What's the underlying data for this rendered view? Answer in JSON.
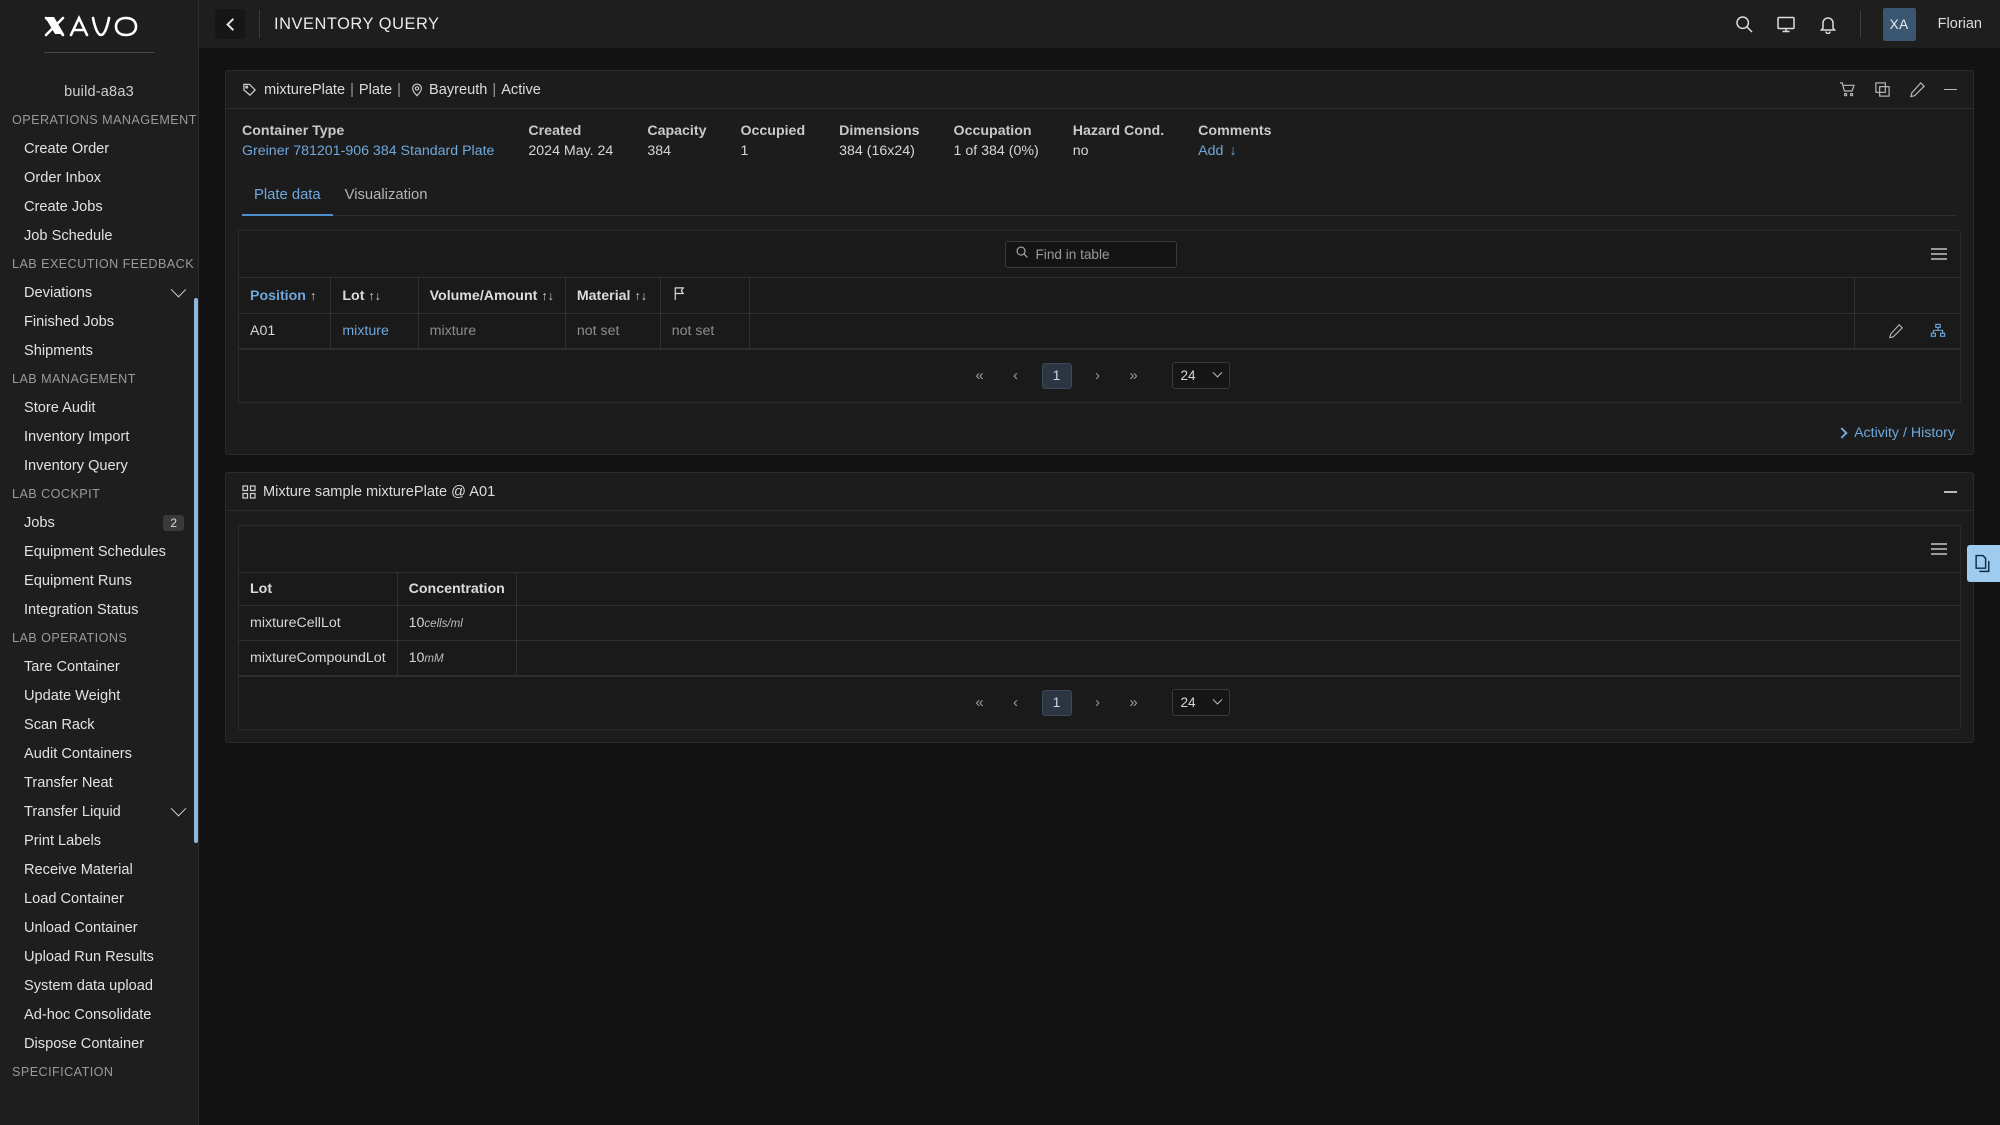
{
  "brand": {
    "logo_text": "XAVO",
    "build": "build-a8a3"
  },
  "sidebar": {
    "sections": [
      {
        "title": "OPERATIONS MANAGEMENT",
        "items": [
          {
            "label": "Create Order"
          },
          {
            "label": "Order Inbox"
          },
          {
            "label": "Create Jobs"
          },
          {
            "label": "Job Schedule"
          }
        ]
      },
      {
        "title": "LAB EXECUTION FEEDBACK",
        "items": [
          {
            "label": "Deviations",
            "expand": true
          },
          {
            "label": "Finished Jobs"
          },
          {
            "label": "Shipments"
          }
        ]
      },
      {
        "title": "LAB MANAGEMENT",
        "items": [
          {
            "label": "Store Audit"
          },
          {
            "label": "Inventory Import"
          },
          {
            "label": "Inventory Query"
          }
        ]
      },
      {
        "title": "LAB COCKPIT",
        "items": [
          {
            "label": "Jobs",
            "badge": "2"
          },
          {
            "label": "Equipment Schedules"
          },
          {
            "label": "Equipment Runs"
          },
          {
            "label": "Integration Status"
          }
        ]
      },
      {
        "title": "LAB OPERATIONS",
        "items": [
          {
            "label": "Tare Container"
          },
          {
            "label": "Update Weight"
          },
          {
            "label": "Scan Rack"
          },
          {
            "label": "Audit Containers"
          },
          {
            "label": "Transfer Neat"
          },
          {
            "label": "Transfer Liquid",
            "expand": true
          },
          {
            "label": "Print Labels"
          },
          {
            "label": "Receive Material"
          },
          {
            "label": "Load Container"
          },
          {
            "label": "Unload Container"
          },
          {
            "label": "Upload Run Results"
          },
          {
            "label": "System data upload"
          },
          {
            "label": "Ad-hoc Consolidate"
          },
          {
            "label": "Dispose Container"
          }
        ]
      },
      {
        "title": "SPECIFICATION",
        "items": []
      }
    ]
  },
  "topbar": {
    "title": "INVENTORY QUERY",
    "back_icon": "chevron-left-icon",
    "search_icon": "search-icon",
    "display_icon": "monitor-icon",
    "notification_icon": "bell-icon",
    "avatar_initials": "XA",
    "user_name": "Florian"
  },
  "container_card": {
    "breadcrumb": {
      "tag_icon": "tag-icon",
      "name": "mixturePlate",
      "sep1": "|",
      "type": "Plate",
      "sep2": "|",
      "location_icon": "location-pin-icon",
      "location": "Bayreuth",
      "sep3": "|",
      "status": "Active"
    },
    "head_icons": [
      "cart-icon",
      "copy-icon",
      "pencil-icon",
      "minimize-icon"
    ],
    "meta": [
      {
        "key": "Container Type",
        "value": "Greiner 781201-906 384 Standard Plate",
        "link": true
      },
      {
        "key": "Created",
        "value": "2024 May. 24"
      },
      {
        "key": "Capacity",
        "value": "384"
      },
      {
        "key": "Occupied",
        "value": "1"
      },
      {
        "key": "Dimensions",
        "value": "384 (16x24)"
      },
      {
        "key": "Occupation",
        "value": "1 of 384 (0%)"
      },
      {
        "key": "Hazard Cond.",
        "value": "no"
      },
      {
        "key": "Comments",
        "value": "Add",
        "add": true
      }
    ],
    "tabs": [
      {
        "label": "Plate data",
        "active": true
      },
      {
        "label": "Visualization",
        "active": false
      }
    ],
    "search": {
      "placeholder": "Find in table",
      "value": "",
      "icon": "search-icon"
    },
    "menu_icon": "list-menu-icon",
    "table": {
      "columns": [
        {
          "label": "Position",
          "sort": "↑",
          "highlight": true
        },
        {
          "label": "Lot",
          "sort": "↑↓"
        },
        {
          "label": "Volume/Amount",
          "sort": "↑↓"
        },
        {
          "label": "Material",
          "sort": "↑↓"
        },
        {
          "label": "",
          "icon": "flag-icon"
        }
      ],
      "rows": [
        {
          "position": "A01",
          "lot": "mixture",
          "volume": "mixture",
          "material": "not set",
          "flag": "not set",
          "actions": [
            "pencil-icon",
            "hierarchy-icon"
          ]
        }
      ]
    },
    "pager": {
      "first": "«",
      "prev": "‹",
      "page": "1",
      "next": "›",
      "last": "»",
      "page_size": "24"
    },
    "footer_link": {
      "label": "Activity / History",
      "icon": "chevron-right-icon"
    }
  },
  "mixture_card": {
    "icon": "grid-icon",
    "title": "Mixture sample mixturePlate @ A01",
    "minimize_icon": "minimize-icon",
    "menu_icon": "list-menu-icon",
    "table": {
      "columns": [
        "Lot",
        "Concentration"
      ],
      "rows": [
        {
          "lot": "mixtureCellLot",
          "value": "10",
          "unit": "cells/ml"
        },
        {
          "lot": "mixtureCompoundLot",
          "value": "10",
          "unit": "mM"
        }
      ]
    },
    "pager": {
      "first": "«",
      "prev": "‹",
      "page": "1",
      "next": "›",
      "last": "»",
      "page_size": "24"
    }
  },
  "float_action": {
    "icon": "copy-document-icon"
  },
  "colors": {
    "accent": "#6ea8dc",
    "sidebar_bg": "#1e1e1e",
    "content_bg": "#121212",
    "card_bg": "#1c1c1c",
    "scrollbar": "#8bb8e0",
    "float_action": "#9fcbef"
  }
}
